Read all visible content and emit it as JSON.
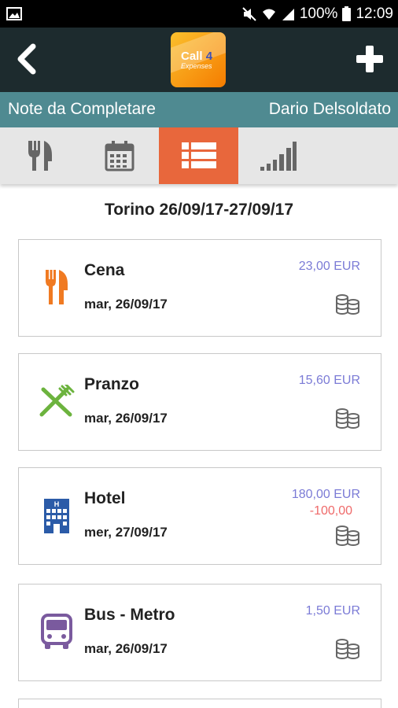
{
  "status_bar": {
    "battery_percent": "100%",
    "time": "12:09"
  },
  "app_bar": {
    "logo_line1": "Call",
    "logo_line1_num": "4",
    "logo_line2": "Expenses"
  },
  "sub_bar": {
    "left": "Note da Completare",
    "right": "Dario Delsoldato"
  },
  "tabs": [
    {
      "icon": "cutlery-icon",
      "active": false
    },
    {
      "icon": "calendar-icon",
      "active": false
    },
    {
      "icon": "list-icon",
      "active": true
    },
    {
      "icon": "signal-bars-icon",
      "active": false
    }
  ],
  "trip_title": "Torino 26/09/17-27/09/17",
  "expenses": [
    {
      "name": "Cena",
      "date": "mar, 26/09/17",
      "amount": "23,00 EUR",
      "deduction": "",
      "icon": "dinner-icon",
      "icon_color": "#f07a22"
    },
    {
      "name": "Pranzo",
      "date": "mar, 26/09/17",
      "amount": "15,60 EUR",
      "deduction": "",
      "icon": "lunch-icon",
      "icon_color": "#6cb33e"
    },
    {
      "name": "Hotel",
      "date": "mer, 27/09/17",
      "amount": "180,00 EUR",
      "deduction": "-100,00",
      "icon": "hotel-icon",
      "icon_color": "#2b5ba8"
    },
    {
      "name": "Bus - Metro",
      "date": "mar, 26/09/17",
      "amount": "1,50 EUR",
      "deduction": "",
      "icon": "bus-icon",
      "icon_color": "#7a5a9e"
    }
  ],
  "colors": {
    "app_bar": "#1d2b2e",
    "sub_bar": "#4f8a91",
    "active_tab": "#e8673c",
    "amount": "#7b7bd6",
    "deduction": "#ef6a6a"
  }
}
